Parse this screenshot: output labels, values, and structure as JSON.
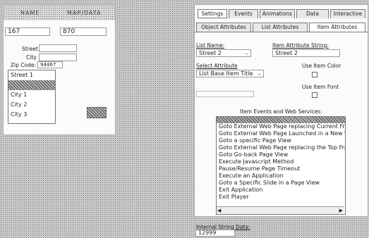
{
  "left_form": {
    "header_left": "NAME",
    "header_right": "MAP/DATA",
    "field1_value": "167",
    "field2_value": "870",
    "street_label": "Street",
    "city_label": "City",
    "zip_label": "Zip Code:",
    "zip_value": "94467",
    "dropdown_items": [
      "Street 1",
      "",
      "City 1",
      "City 2",
      "City 3"
    ]
  },
  "right_panel": {
    "tabs_row1": [
      "Settings",
      "Events",
      "Animations",
      "Data",
      "Interactive"
    ],
    "tabs_row2": [
      "Object Attributes",
      "List Attributes",
      "Item Attributes"
    ],
    "list_name_label": "List Name:",
    "list_name_value": "Street 2",
    "item_attr_string_label": "Item Attribute String:",
    "item_attr_string_value": "Street 2",
    "select_attribute_label": "Select Attribute",
    "select_attribute_value": "List Base Item Title",
    "use_item_color_label": "Use Item Color",
    "use_item_font_label": "Use Item Font",
    "item_events_label": "Item Events and Web Services:",
    "events": [
      "",
      "Goto External Web Page replacing Current Frame",
      "Goto External Web Page Launched in a New Window",
      "Goto a specific Page View",
      "Goto External Web Page replacing the Top Frame",
      "Goto Go-back Page View",
      "Execute Javascript Method",
      "Pause/Resume Page Timeout",
      "Execute an Application",
      "Goto a Specific Slide in a Page View",
      "Exit Application",
      "Exit Player"
    ],
    "internal_string_label": "Internal String Data:",
    "internal_string_value": "12999"
  }
}
